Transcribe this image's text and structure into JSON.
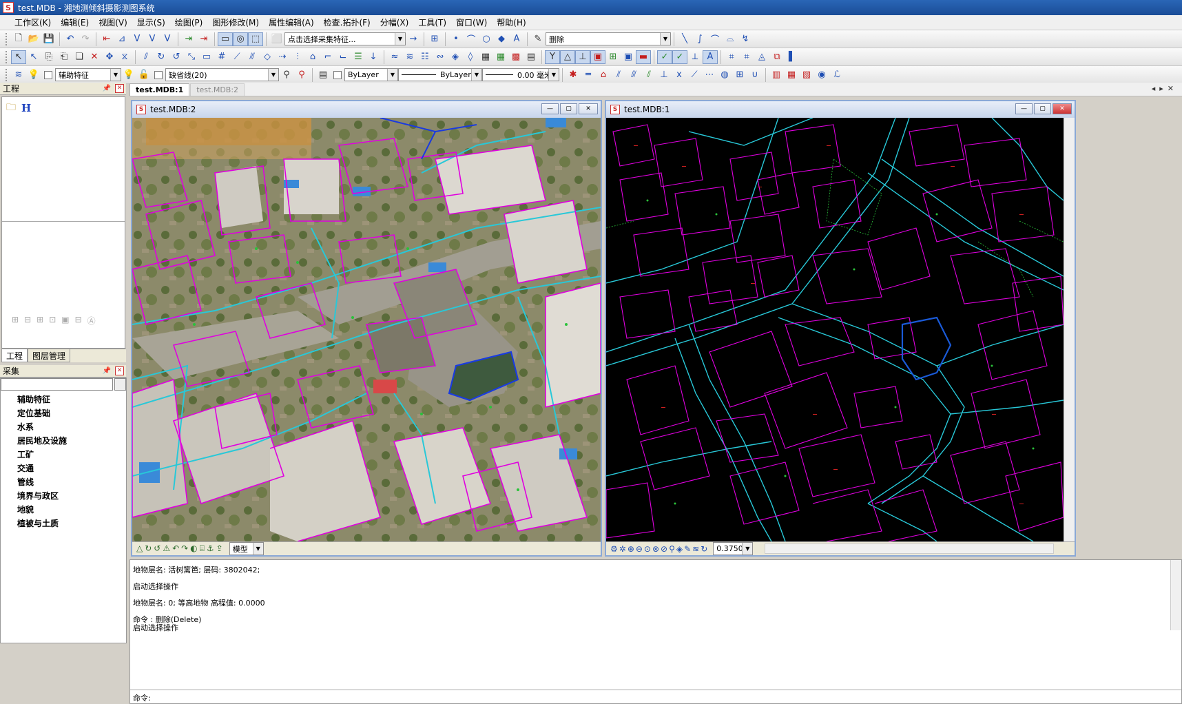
{
  "window": {
    "title": "test.MDB - 湘地测倾斜摄影测图系统",
    "icon_letter": "S"
  },
  "menu": [
    "工作区(K)",
    "编辑(E)",
    "视图(V)",
    "显示(S)",
    "绘图(P)",
    "图形修改(M)",
    "属性编辑(A)",
    "检查.拓扑(F)",
    "分幅(X)",
    "工具(T)",
    "窗口(W)",
    "帮助(H)"
  ],
  "toolbar1": {
    "feature_select": "点击选择采集特征...",
    "command_combo": "删除"
  },
  "toolbar3": {
    "feature_label": "辅助特征",
    "layer_combo": "缺省线(20)",
    "color_combo": "ByLayer",
    "linetype_combo": "ByLayer",
    "lineweight_combo": "0.00 毫米"
  },
  "doc_tabs": [
    "test.MDB:1",
    "test.MDB:2"
  ],
  "project_pane": {
    "title": "工程",
    "root_label": "H",
    "tabs": [
      "工程",
      "图层管理"
    ]
  },
  "collect_pane": {
    "title": "采集",
    "categories": [
      "辅助特征",
      "定位基础",
      "水系",
      "居民地及设施",
      "工矿",
      "交通",
      "管线",
      "境界与政区",
      "地貌",
      "植被与土质"
    ]
  },
  "view_left": {
    "title": "test.MDB:2",
    "mode_combo": "模型"
  },
  "view_right": {
    "title": "test.MDB:1",
    "scale_combo": "0.3750"
  },
  "console": {
    "lines": [
      "地物层名: 活树篱笆; 层码: 3802042;",
      "启动选择操作",
      "地物层名: 0; 等高地物 高程值: 0.0000",
      "命令 : 删除(Delete)",
      "启动选择操作"
    ],
    "prompt": "命令:"
  },
  "colors": {
    "building": "#e000e0",
    "road": "#28c8d8",
    "vegetation": "#2ac23a",
    "pond": "#1a5ad8"
  }
}
